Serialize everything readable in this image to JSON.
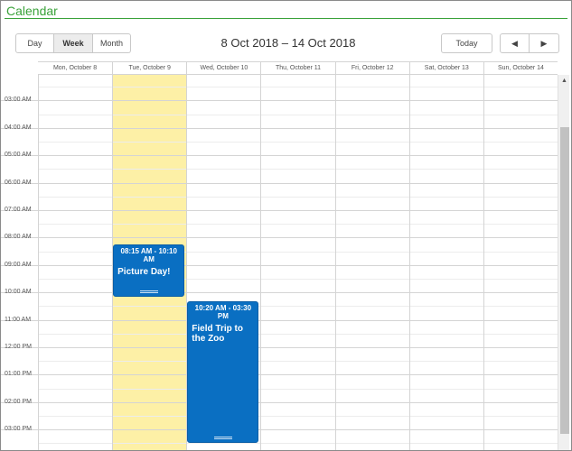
{
  "app": {
    "title": "Calendar"
  },
  "toolbar": {
    "views": [
      {
        "label": "Day",
        "active": false
      },
      {
        "label": "Week",
        "active": true
      },
      {
        "label": "Month",
        "active": false
      }
    ],
    "range": "8 Oct 2018 – 14 Oct 2018",
    "today_label": "Today",
    "prev_icon": "◀",
    "next_icon": "▶"
  },
  "days": [
    {
      "label": "Mon, October 8",
      "today": false
    },
    {
      "label": "Tue, October 9",
      "today": true
    },
    {
      "label": "Wed, October 10",
      "today": false
    },
    {
      "label": "Thu, October 11",
      "today": false
    },
    {
      "label": "Fri, October 12",
      "today": false
    },
    {
      "label": "Sat, October 13",
      "today": false
    },
    {
      "label": "Sun, October 14",
      "today": false
    }
  ],
  "times": [
    "02:00 AM",
    "03:00 AM",
    "04:00 AM",
    "05:00 AM",
    "06:00 AM",
    "07:00 AM",
    "08:00 AM",
    "09:00 AM",
    "10:00 AM",
    "11:00 AM",
    "12:00 PM",
    "01:00 PM",
    "02:00 PM",
    "03:00 PM"
  ],
  "events": [
    {
      "day": 1,
      "time": "08:15 AM - 10:10 AM",
      "title": "Picture Day!",
      "start_hour": 8.25,
      "end_hour": 10.1667
    },
    {
      "day": 2,
      "time": "10:20 AM - 03:30 PM",
      "title": "Field Trip to the Zoo",
      "start_hour": 10.3333,
      "end_hour": 15.5
    }
  ],
  "colors": {
    "accent": "#3aa23a",
    "event": "#0a6fc2",
    "today_column": "#fdf0a6"
  },
  "scrollbar": {
    "up_icon": "▲"
  }
}
